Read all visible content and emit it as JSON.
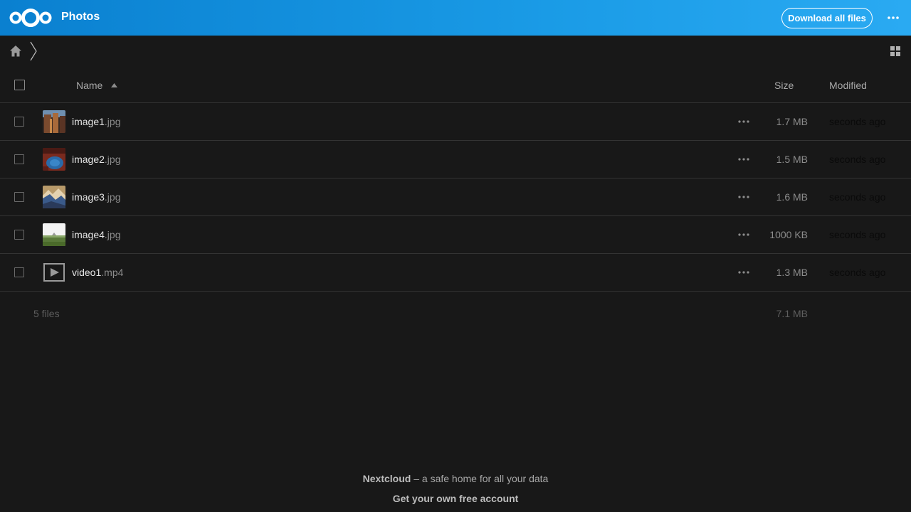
{
  "header": {
    "app_title": "Photos",
    "download_label": "Download all files",
    "accent_color": "#1a9be6"
  },
  "breadcrumb": {
    "home_icon": "home-icon"
  },
  "table": {
    "columns": {
      "name": "Name",
      "size": "Size",
      "modified": "Modified"
    },
    "rows": [
      {
        "base": "image1",
        "ext": ".jpg",
        "size": "1.7 MB",
        "modified": "seconds ago"
      },
      {
        "base": "image2",
        "ext": ".jpg",
        "size": "1.5 MB",
        "modified": "seconds ago"
      },
      {
        "base": "image3",
        "ext": ".jpg",
        "size": "1.6 MB",
        "modified": "seconds ago"
      },
      {
        "base": "image4",
        "ext": ".jpg",
        "size": "1000 KB",
        "modified": "seconds ago"
      },
      {
        "base": "video1",
        "ext": ".mp4",
        "size": "1.3 MB",
        "modified": "seconds ago"
      }
    ]
  },
  "summary": {
    "count": "5 files",
    "total_size": "7.1 MB"
  },
  "footer": {
    "brand": "Nextcloud",
    "tagline": " – a safe home for all your data",
    "link": "Get your own free account"
  }
}
